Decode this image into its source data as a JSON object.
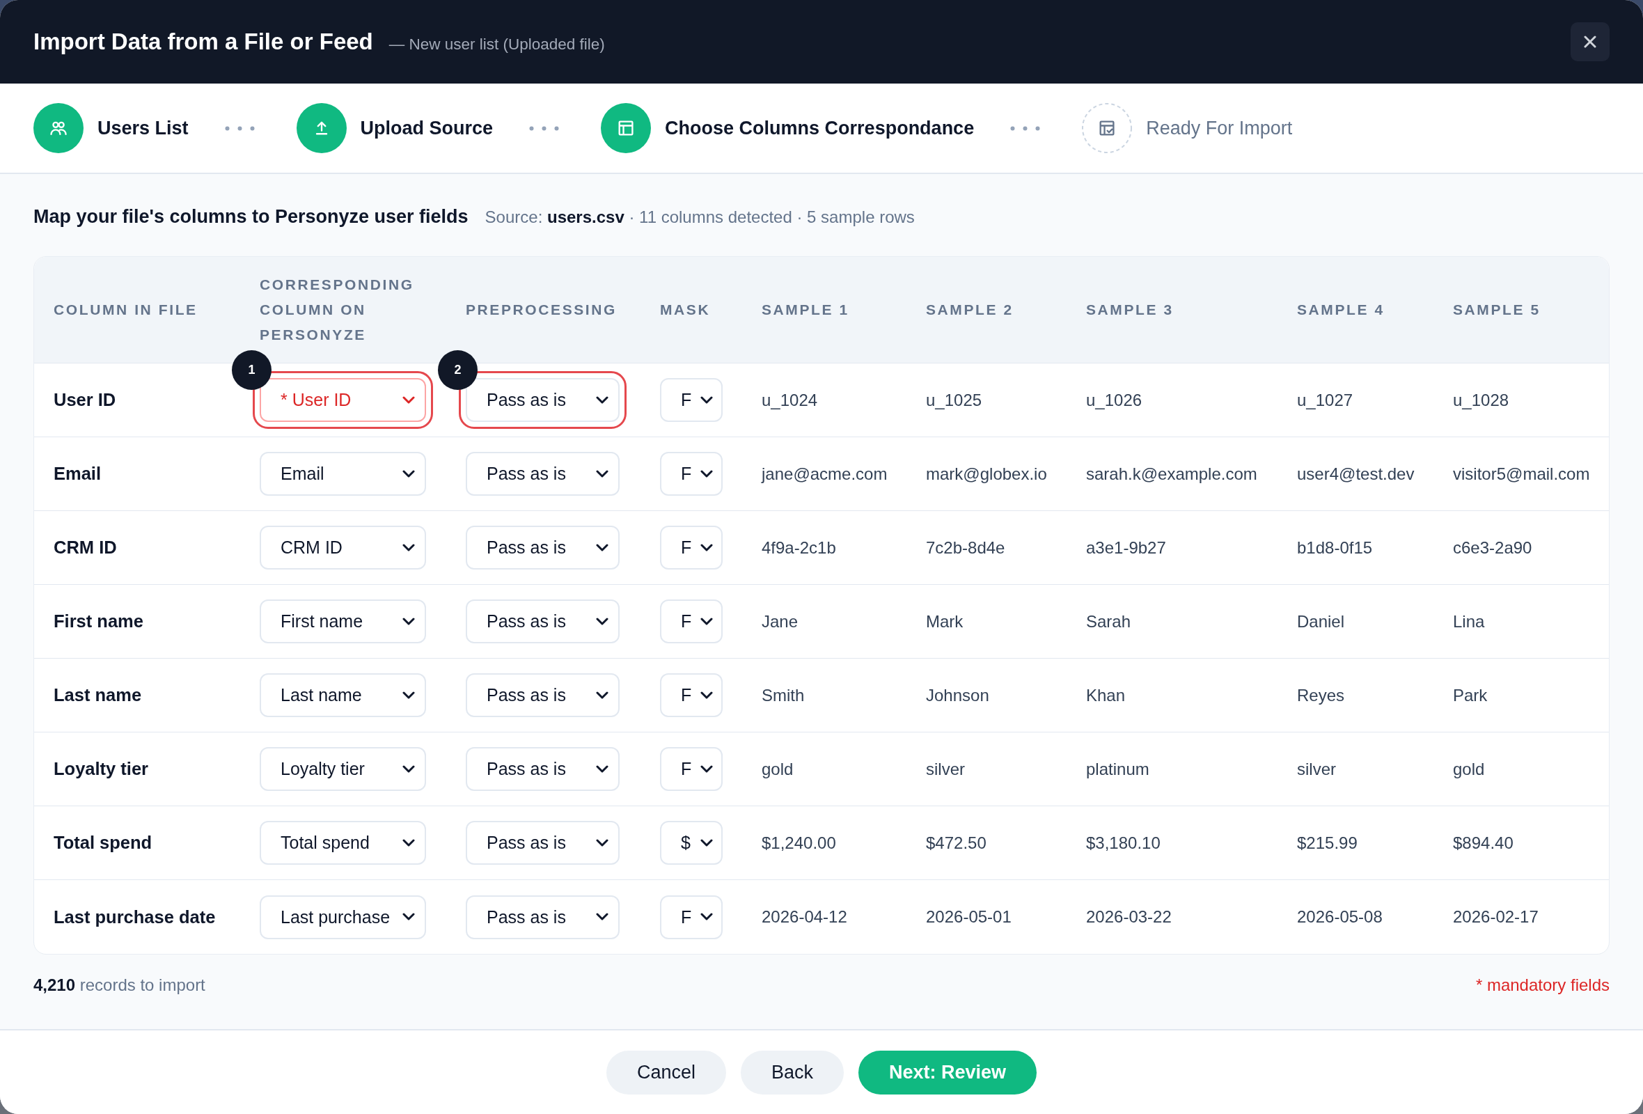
{
  "dialog": {
    "title": "Import Data from a File or Feed",
    "subtitle": "— New user list (Uploaded file)"
  },
  "steps": [
    {
      "label": "Users List",
      "done": true
    },
    {
      "label": "Upload Source",
      "done": true
    },
    {
      "label": "Choose Columns Correspondance",
      "done": true
    },
    {
      "label": "Ready For Import",
      "done": false
    }
  ],
  "heading": "Map your file's columns to Personyze user fields",
  "source_note": "Source: **users.csv** · 11 columns detected · 5 sample rows",
  "table": {
    "columns": [
      "COLUMN IN FILE",
      "CORRESPONDING COLUMN ON PERSONYZE",
      "PREPROCESSING",
      "MASK",
      "SAMPLE 1",
      "SAMPLE 2",
      "SAMPLE 3",
      "SAMPLE 4",
      "SAMPLE 5"
    ],
    "rows": [
      {
        "column": "User ID",
        "mapping": {
          "value": "* User ID",
          "mandatory": true,
          "callout": "1"
        },
        "preprocessing": {
          "value": "Pass as is",
          "callout": "2"
        },
        "mask": "F",
        "samples": [
          "u_1024",
          "u_1025",
          "u_1026",
          "u_1027",
          "u_1028"
        ]
      },
      {
        "column": "Email",
        "mapping": {
          "value": "Email",
          "mandatory": false
        },
        "preprocessing": {
          "value": "Pass as is"
        },
        "mask": "F",
        "samples": [
          "jane@acme.com",
          "mark@globex.io",
          "sarah.k@example.com",
          "user4@test.dev",
          "visitor5@mail.com"
        ]
      },
      {
        "column": "CRM ID",
        "mapping": {
          "value": "CRM ID",
          "mandatory": false
        },
        "preprocessing": {
          "value": "Pass as is"
        },
        "mask": "F",
        "samples": [
          "4f9a-2c1b",
          "7c2b-8d4e",
          "a3e1-9b27",
          "b1d8-0f15",
          "c6e3-2a90"
        ]
      },
      {
        "column": "First name",
        "mapping": {
          "value": "First name",
          "mandatory": false
        },
        "preprocessing": {
          "value": "Pass as is"
        },
        "mask": "F",
        "samples": [
          "Jane",
          "Mark",
          "Sarah",
          "Daniel",
          "Lina"
        ]
      },
      {
        "column": "Last name",
        "mapping": {
          "value": "Last name",
          "mandatory": false
        },
        "preprocessing": {
          "value": "Pass as is"
        },
        "mask": "F",
        "samples": [
          "Smith",
          "Johnson",
          "Khan",
          "Reyes",
          "Park"
        ]
      },
      {
        "column": "Loyalty tier",
        "mapping": {
          "value": "Loyalty tier",
          "mandatory": false
        },
        "preprocessing": {
          "value": "Pass as is"
        },
        "mask": "F",
        "samples": [
          "gold",
          "silver",
          "platinum",
          "silver",
          "gold"
        ]
      },
      {
        "column": "Total spend",
        "mapping": {
          "value": "Total spend",
          "mandatory": false
        },
        "preprocessing": {
          "value": "Pass as is"
        },
        "mask": "$",
        "samples": [
          "$1,240.00",
          "$472.50",
          "$3,180.10",
          "$215.99",
          "$894.40"
        ]
      },
      {
        "column": "Last purchase date",
        "mapping": {
          "value": "Last purchase",
          "mandatory": false
        },
        "preprocessing": {
          "value": "Pass as is"
        },
        "mask": "F",
        "samples": [
          "2026-04-12",
          "2026-05-01",
          "2026-03-22",
          "2026-05-08",
          "2026-02-17"
        ]
      }
    ]
  },
  "summary": "**4,210** records to import",
  "mandatory_note": "* mandatory fields",
  "buttons": [
    {
      "label": "Cancel",
      "kind": "secondary"
    },
    {
      "label": "Back",
      "kind": "secondary"
    },
    {
      "label": "Next: Review",
      "kind": "primary"
    }
  ]
}
